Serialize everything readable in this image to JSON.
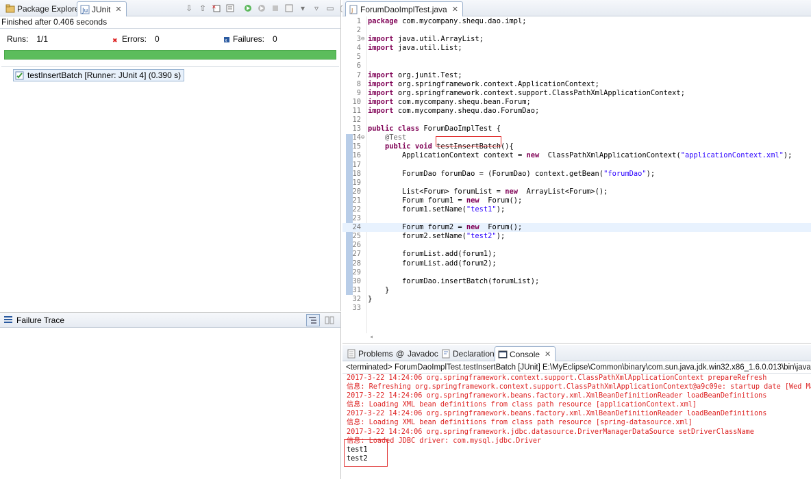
{
  "junit_view": {
    "tabs": [
      {
        "label": "Package Explorer",
        "icon": "package-explorer-icon"
      },
      {
        "label": "JUnit",
        "icon": "junit-icon"
      }
    ],
    "status": "Finished after 0.406 seconds",
    "runs_label": "Runs:",
    "runs_value": "1/1",
    "errors_label": "Errors:",
    "errors_value": "0",
    "failures_label": "Failures:",
    "failures_value": "0",
    "progress": 1.0,
    "progress_color": "#5cbd5c",
    "test_row": "testInsertBatch [Runner: JUnit 4] (0.390 s)",
    "failure_trace_label": "Failure Trace"
  },
  "editor": {
    "tab_label": "ForumDaoImplTest.java",
    "lines": [
      {
        "n": "1",
        "m": "",
        "t": [
          [
            "kw",
            "package"
          ],
          [
            "",
            "com.mycompany.shequ.dao.impl;"
          ]
        ]
      },
      {
        "n": "2",
        "m": "",
        "t": []
      },
      {
        "n": "3",
        "m": "⊖",
        "t": [
          [
            "kw",
            "import"
          ],
          [
            "",
            "java.util.ArrayList;"
          ]
        ]
      },
      {
        "n": "4",
        "m": "",
        "t": [
          [
            "kw",
            "import"
          ],
          [
            "",
            "java.util.List;"
          ]
        ]
      },
      {
        "n": "5",
        "m": "",
        "t": []
      },
      {
        "n": "6",
        "m": "",
        "t": []
      },
      {
        "n": "7",
        "m": "",
        "t": [
          [
            "kw",
            "import"
          ],
          [
            "",
            "org.junit.Test;"
          ]
        ]
      },
      {
        "n": "8",
        "m": "",
        "t": [
          [
            "kw",
            "import"
          ],
          [
            "",
            "org.springframework.context.ApplicationContext;"
          ]
        ]
      },
      {
        "n": "9",
        "m": "",
        "t": [
          [
            "kw",
            "import"
          ],
          [
            "",
            "org.springframework.context.support.ClassPathXmlApplicationContext;"
          ]
        ]
      },
      {
        "n": "10",
        "m": "",
        "t": [
          [
            "kw",
            "import"
          ],
          [
            "",
            "com.mycompany.shequ.bean.Forum;"
          ]
        ]
      },
      {
        "n": "11",
        "m": "",
        "t": [
          [
            "kw",
            "import"
          ],
          [
            "",
            "com.mycompany.shequ.dao.ForumDao;"
          ]
        ]
      },
      {
        "n": "12",
        "m": "",
        "t": []
      },
      {
        "n": "13",
        "m": "",
        "t": [
          [
            "kw",
            "public class"
          ],
          [
            "",
            "ForumDaoImplTest {"
          ]
        ]
      },
      {
        "n": "14",
        "m": "⊖",
        "t": [
          [
            "an",
            "    @Test"
          ]
        ]
      },
      {
        "n": "15",
        "m": "",
        "t": [
          [
            "kw",
            "    public void"
          ],
          [
            "",
            "testInsertBatch(){"
          ]
        ]
      },
      {
        "n": "16",
        "m": "",
        "t": [
          [
            "",
            "        ApplicationContext context = "
          ],
          [
            "kw",
            "new"
          ],
          [
            "",
            " ClassPathXmlApplicationContext("
          ],
          [
            "st",
            "\"applicationContext.xml\""
          ],
          [
            "",
            ");"
          ]
        ]
      },
      {
        "n": "17",
        "m": "",
        "t": []
      },
      {
        "n": "18",
        "m": "",
        "t": [
          [
            "",
            "        ForumDao forumDao = (ForumDao) context.getBean("
          ],
          [
            "st",
            "\"forumDao\""
          ],
          [
            "",
            ");"
          ]
        ]
      },
      {
        "n": "19",
        "m": "",
        "t": []
      },
      {
        "n": "20",
        "m": "",
        "t": [
          [
            "",
            "        List<Forum> forumList = "
          ],
          [
            "kw",
            "new"
          ],
          [
            "",
            " ArrayList<Forum>();"
          ]
        ]
      },
      {
        "n": "21",
        "m": "",
        "t": [
          [
            "",
            "        Forum forum1 = "
          ],
          [
            "kw",
            "new"
          ],
          [
            "",
            " Forum();"
          ]
        ]
      },
      {
        "n": "22",
        "m": "",
        "t": [
          [
            "",
            "        forum1.setName("
          ],
          [
            "st",
            "\"test1\""
          ],
          [
            "",
            ");"
          ]
        ]
      },
      {
        "n": "23",
        "m": "",
        "t": []
      },
      {
        "n": "24",
        "m": "",
        "t": [
          [
            "",
            "        Forum forum2 = "
          ],
          [
            "kw",
            "new"
          ],
          [
            "",
            " Forum();"
          ]
        ]
      },
      {
        "n": "25",
        "m": "",
        "t": [
          [
            "",
            "        forum2.setName("
          ],
          [
            "st",
            "\"test2\""
          ],
          [
            "",
            ");"
          ]
        ]
      },
      {
        "n": "26",
        "m": "",
        "t": []
      },
      {
        "n": "27",
        "m": "",
        "t": [
          [
            "",
            "        forumList.add(forum1);"
          ]
        ]
      },
      {
        "n": "28",
        "m": "",
        "t": [
          [
            "",
            "        forumList.add(forum2);"
          ]
        ]
      },
      {
        "n": "29",
        "m": "",
        "t": []
      },
      {
        "n": "30",
        "m": "",
        "t": [
          [
            "",
            "        forumDao.insertBatch(forumList);"
          ]
        ]
      },
      {
        "n": "31",
        "m": "",
        "t": [
          [
            "",
            "    }"
          ]
        ]
      },
      {
        "n": "32",
        "m": "",
        "t": [
          [
            "",
            "}"
          ]
        ]
      },
      {
        "n": "33",
        "m": "",
        "t": []
      }
    ],
    "highlighted_line": "24"
  },
  "console_view": {
    "tabs": [
      {
        "label": "Problems",
        "icon": "problems-icon"
      },
      {
        "label": "Javadoc",
        "icon": "javadoc-icon"
      },
      {
        "label": "Declaration",
        "icon": "declaration-icon"
      },
      {
        "label": "Console",
        "icon": "console-icon"
      }
    ],
    "status": "<terminated> ForumDaoImplTest.testInsertBatch [JUnit] E:\\MyEclipse\\Common\\binary\\com.sun.java.jdk.win32.x86_1.6.0.013\\bin\\javaw.",
    "lines": [
      {
        "kind": "err",
        "text": "2017-3-22 14:24:06 org.springframework.context.support.ClassPathXmlApplicationContext prepareRefresh"
      },
      {
        "kind": "err",
        "text": "信息: Refreshing org.springframework.context.support.ClassPathXmlApplicationContext@a9c09e: startup date [Wed Mar"
      },
      {
        "kind": "err",
        "text": "2017-3-22 14:24:06 org.springframework.beans.factory.xml.XmlBeanDefinitionReader loadBeanDefinitions"
      },
      {
        "kind": "err",
        "text": "信息: Loading XML bean definitions from class path resource [applicationContext.xml]"
      },
      {
        "kind": "err",
        "text": "2017-3-22 14:24:06 org.springframework.beans.factory.xml.XmlBeanDefinitionReader loadBeanDefinitions"
      },
      {
        "kind": "err",
        "text": "信息: Loading XML bean definitions from class path resource [spring-datasource.xml]"
      },
      {
        "kind": "err",
        "text": "2017-3-22 14:24:06 org.springframework.jdbc.datasource.DriverManagerDataSource setDriverClassName"
      },
      {
        "kind": "err",
        "text": "信息: Loaded JDBC driver: com.mysql.jdbc.Driver"
      },
      {
        "kind": "out",
        "text": "test1"
      },
      {
        "kind": "out",
        "text": "test2"
      }
    ]
  },
  "colors": {
    "keyword": "#7f0055",
    "string": "#2a00ff",
    "annotation": "#646464",
    "console_error": "#dd2222",
    "annotation_box": "#e03030"
  }
}
